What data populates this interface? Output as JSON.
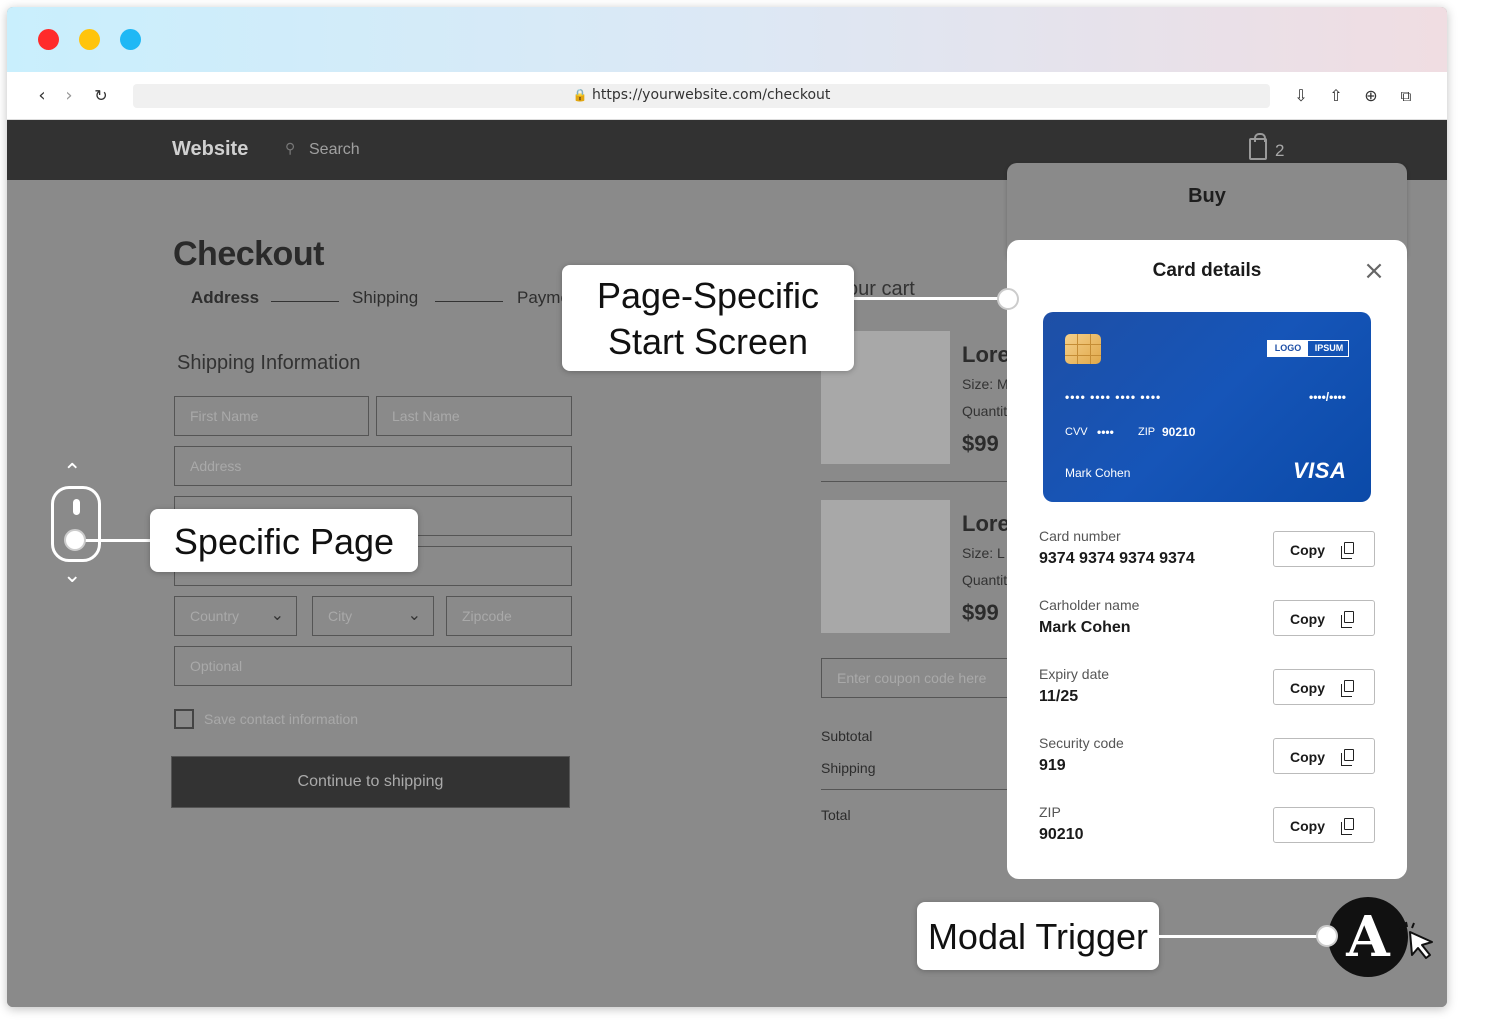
{
  "browser": {
    "url": "https://yourwebsite.com/checkout",
    "dots": [
      "#ff2b2b",
      "#ffc40c",
      "#1fb8f5"
    ]
  },
  "site": {
    "brand": "Website",
    "search_placeholder": "Search",
    "cart_count": "2"
  },
  "checkout": {
    "title": "Checkout",
    "steps": [
      "Address",
      "Shipping",
      "Payme"
    ],
    "section_title": "Shipping Information",
    "fields": {
      "first_name": "First Name",
      "last_name": "Last Name",
      "address": "Address",
      "country": "Country",
      "city": "City",
      "zipcode": "Zipcode",
      "optional": "Optional"
    },
    "save_label": "Save contact information",
    "continue_label": "Continue to shipping"
  },
  "cart": {
    "title": "our cart",
    "items": [
      {
        "name": "Lore",
        "size": "Size: M",
        "qty": "Quantit",
        "price": "$99"
      },
      {
        "name": "Lore",
        "size": "Size: L",
        "qty": "Quantit",
        "price": "$99"
      }
    ],
    "coupon_placeholder": "Enter coupon code here",
    "subtotal": "Subtotal",
    "shipping": "Shipping",
    "total": "Total"
  },
  "buy_panel": {
    "title": "Buy"
  },
  "modal": {
    "title": "Card details",
    "card": {
      "logo_a": "LOGO",
      "logo_b": "IPSUM",
      "number_masked": "•••• •••• •••• ••••",
      "expiry_masked": "••••/••••",
      "cvv_label": "CVV",
      "cvv_masked": "••••",
      "zip_label": "ZIP",
      "zip_value": "90210",
      "holder": "Mark Cohen",
      "brand": "VISA"
    },
    "rows": [
      {
        "label": "Card number",
        "value": "9374 9374 9374 9374",
        "button": "Copy"
      },
      {
        "label": "Carholder name",
        "value": "Mark Cohen",
        "button": "Copy"
      },
      {
        "label": "Expiry date",
        "value": "11/25",
        "button": "Copy"
      },
      {
        "label": "Security code",
        "value": "919",
        "button": "Copy"
      },
      {
        "label": "ZIP",
        "value": "90210",
        "button": "Copy"
      }
    ]
  },
  "callouts": {
    "start_screen_line1": "Page-Specific",
    "start_screen_line2": "Start Screen",
    "specific_page": "Specific Page",
    "modal_trigger": "Modal Trigger",
    "trigger_letter": "A"
  }
}
